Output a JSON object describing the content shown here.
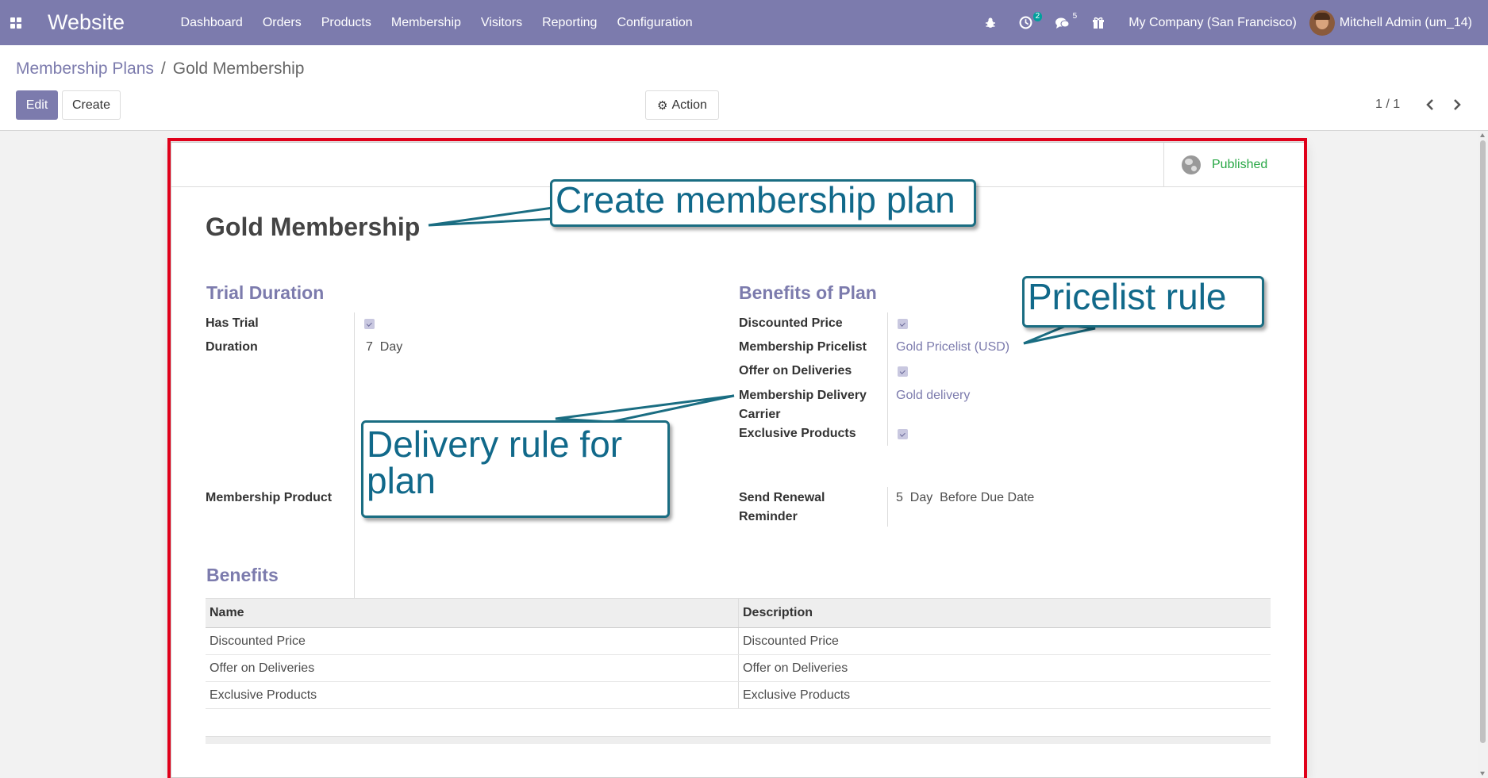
{
  "navbar": {
    "brand": "Website",
    "menu": [
      "Dashboard",
      "Orders",
      "Products",
      "Membership",
      "Visitors",
      "Reporting",
      "Configuration"
    ],
    "activity_count": "2",
    "message_count": "5",
    "company": "My Company (San Francisco)",
    "user": "Mitchell Admin (um_14)"
  },
  "breadcrumb": {
    "parent": "Membership Plans",
    "separator": "/",
    "current": "Gold Membership"
  },
  "buttons": {
    "edit": "Edit",
    "create": "Create",
    "action": "Action"
  },
  "pager": {
    "value": "1 / 1"
  },
  "form": {
    "status": "Published",
    "title": "Gold Membership",
    "trial": {
      "section": "Trial Duration",
      "has_trial_label": "Has Trial",
      "has_trial": true,
      "duration_label": "Duration",
      "duration_value": "7",
      "duration_unit": "Day"
    },
    "membership_product_label": "Membership Product",
    "benefits_plan": {
      "section": "Benefits of Plan",
      "discounted_label": "Discounted Price",
      "discounted": true,
      "pricelist_label": "Membership Pricelist",
      "pricelist_value": "Gold Pricelist (USD)",
      "offer_label": "Offer on Deliveries",
      "offer": true,
      "carrier_label_1": "Membership Delivery",
      "carrier_label_2": "Carrier",
      "carrier_value": "Gold delivery",
      "exclusive_label": "Exclusive Products",
      "exclusive": true
    },
    "renewal": {
      "label_1": "Send Renewal",
      "label_2": "Reminder",
      "value": "5",
      "unit": "Day",
      "when": "Before Due Date"
    },
    "benefits": {
      "section": "Benefits",
      "columns": [
        "Name",
        "Description"
      ],
      "rows": [
        [
          "Discounted Price",
          "Discounted Price"
        ],
        [
          "Offer on Deliveries",
          "Offer on Deliveries"
        ],
        [
          "Exclusive Products",
          "Exclusive Products"
        ]
      ]
    }
  },
  "callouts": {
    "create_plan": "Create membership plan",
    "pricelist_rule": "Pricelist rule",
    "delivery_rule_1": "Delivery rule for",
    "delivery_rule_2": "plan"
  },
  "colors": {
    "navbar": "#7c7bad",
    "accent": "#7c7bad",
    "published": "#28a745",
    "callout": "#1a6d82",
    "frame": "#e0001a"
  }
}
